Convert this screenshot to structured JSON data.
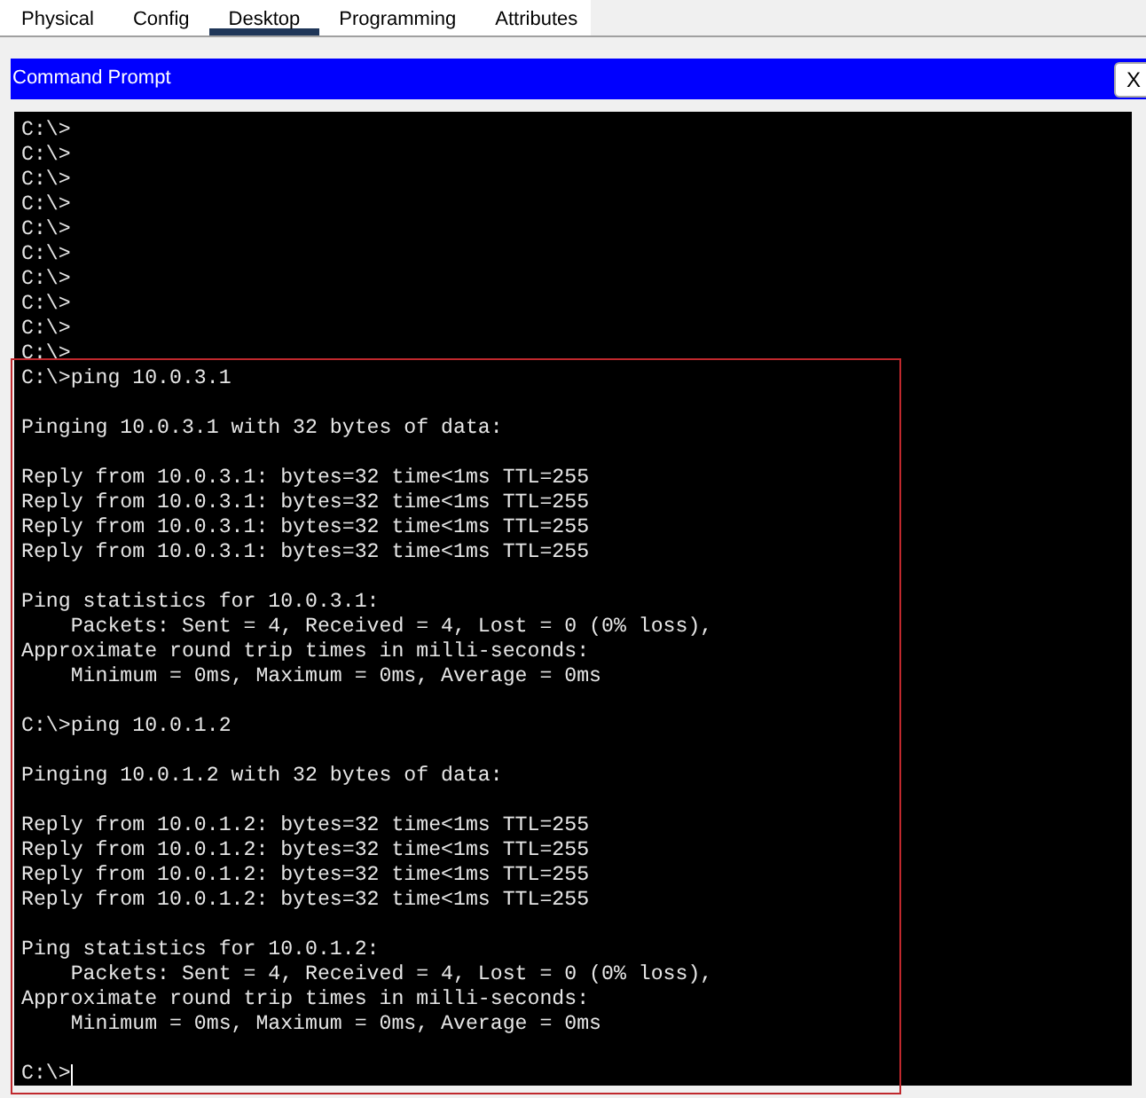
{
  "tabs": [
    {
      "label": "Physical",
      "selected": false
    },
    {
      "label": "Config",
      "selected": false
    },
    {
      "label": "Desktop",
      "selected": true
    },
    {
      "label": "Programming",
      "selected": false
    },
    {
      "label": "Attributes",
      "selected": false
    }
  ],
  "window": {
    "title": "Command Prompt",
    "close_button": "X"
  },
  "terminal": {
    "lines": [
      {
        "kind": "text",
        "text": "C:\\>"
      },
      {
        "kind": "text",
        "text": "C:\\>"
      },
      {
        "kind": "text",
        "text": "C:\\>"
      },
      {
        "kind": "text",
        "text": "C:\\>"
      },
      {
        "kind": "text",
        "text": "C:\\>"
      },
      {
        "kind": "text",
        "text": "C:\\>"
      },
      {
        "kind": "text",
        "text": "C:\\>"
      },
      {
        "kind": "text",
        "text": "C:\\>"
      },
      {
        "kind": "text",
        "text": "C:\\>"
      },
      {
        "kind": "text",
        "text": "C:\\>"
      },
      {
        "kind": "text",
        "text": "C:\\>ping 10.0.3.1"
      },
      {
        "kind": "blank"
      },
      {
        "kind": "text",
        "text": "Pinging 10.0.3.1 with 32 bytes of data:"
      },
      {
        "kind": "blank"
      },
      {
        "kind": "text",
        "text": "Reply from 10.0.3.1: bytes=32 time<1ms TTL=255"
      },
      {
        "kind": "text",
        "text": "Reply from 10.0.3.1: bytes=32 time<1ms TTL=255"
      },
      {
        "kind": "text",
        "text": "Reply from 10.0.3.1: bytes=32 time<1ms TTL=255"
      },
      {
        "kind": "text",
        "text": "Reply from 10.0.3.1: bytes=32 time<1ms TTL=255"
      },
      {
        "kind": "blank"
      },
      {
        "kind": "text",
        "text": "Ping statistics for 10.0.3.1:"
      },
      {
        "kind": "text",
        "text": "    Packets: Sent = 4, Received = 4, Lost = 0 (0% loss),"
      },
      {
        "kind": "text",
        "text": "Approximate round trip times in milli-seconds:"
      },
      {
        "kind": "text",
        "text": "    Minimum = 0ms, Maximum = 0ms, Average = 0ms"
      },
      {
        "kind": "blank"
      },
      {
        "kind": "text",
        "text": "C:\\>ping 10.0.1.2"
      },
      {
        "kind": "blank"
      },
      {
        "kind": "text",
        "text": "Pinging 10.0.1.2 with 32 bytes of data:"
      },
      {
        "kind": "blank"
      },
      {
        "kind": "text",
        "text": "Reply from 10.0.1.2: bytes=32 time<1ms TTL=255"
      },
      {
        "kind": "text",
        "text": "Reply from 10.0.1.2: bytes=32 time<1ms TTL=255"
      },
      {
        "kind": "text",
        "text": "Reply from 10.0.1.2: bytes=32 time<1ms TTL=255"
      },
      {
        "kind": "text",
        "text": "Reply from 10.0.1.2: bytes=32 time<1ms TTL=255"
      },
      {
        "kind": "blank"
      },
      {
        "kind": "text",
        "text": "Ping statistics for 10.0.1.2:"
      },
      {
        "kind": "text",
        "text": "    Packets: Sent = 4, Received = 4, Lost = 0 (0% loss),"
      },
      {
        "kind": "text",
        "text": "Approximate round trip times in milli-seconds:"
      },
      {
        "kind": "text",
        "text": "    Minimum = 0ms, Maximum = 0ms, Average = 0ms"
      },
      {
        "kind": "blank"
      },
      {
        "kind": "prompt",
        "text": "C:\\>",
        "cursor": true
      }
    ]
  }
}
